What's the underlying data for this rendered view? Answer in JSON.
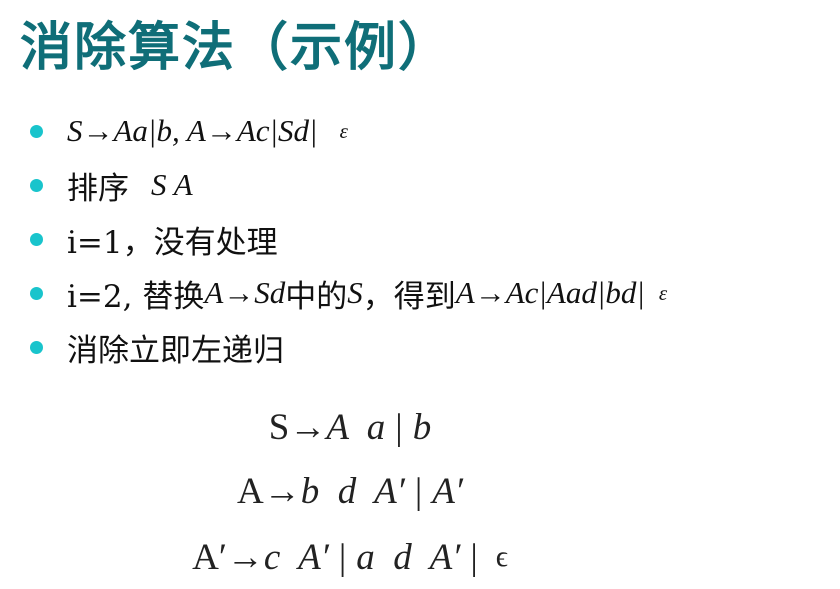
{
  "slide": {
    "title": "消除算法（示例）",
    "bullets": [
      {
        "text": "S→Aa|b, A→Ac|Sd|",
        "epsilon": "ε"
      },
      {
        "label": "排序",
        "math": "S A"
      },
      {
        "text": "i=1，没有处理"
      },
      {
        "prefix": "i=2, 替换",
        "math1": "A→Sd",
        "mid": "中的",
        "math2": "S",
        "rest": "，得到",
        "math3": "A→Ac|Aad|bd|",
        "epsilon": "ε"
      },
      {
        "text": "消除立即左递归"
      }
    ],
    "rules": [
      {
        "lhs": "S→",
        "body": "A  a",
        "alts": [
          "b"
        ]
      },
      {
        "lhs": "A→",
        "body": "b  d  A′",
        "alts": [
          "A′"
        ]
      },
      {
        "lhs": "A′→",
        "body": "c  A′",
        "alts": [
          "a  d  A′"
        ],
        "epsilon": "ϵ"
      }
    ],
    "colors": {
      "title": "#0f6e78",
      "bullet_dot": "#19c4cc"
    }
  }
}
